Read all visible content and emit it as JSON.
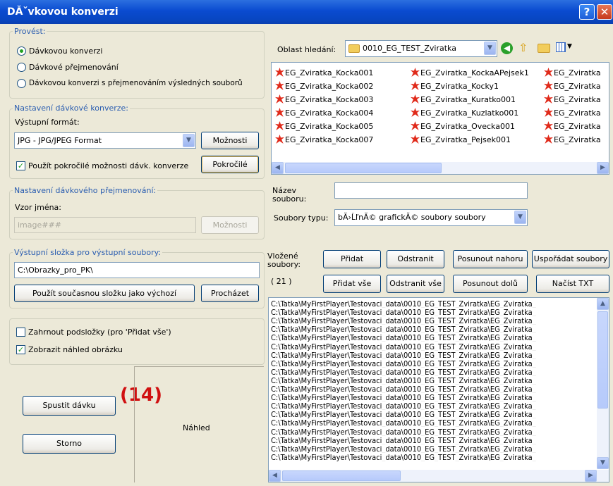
{
  "window": {
    "title": "DĂˇvkovou konverzi",
    "help_icon": "question-icon",
    "close_icon": "close-icon"
  },
  "provest": {
    "legend": "Provést:",
    "options": [
      "Dávkovou konverzi",
      "Dávkové přejmenování",
      "Dávkovou konverzi s přejmenováním výsledných souborů"
    ],
    "selected": 0
  },
  "konverze": {
    "legend": "Nastavení dávkové konverze:",
    "format_label": "Výstupní formát:",
    "format_value": "JPG - JPG/JPEG Format",
    "moznosti_label": "Možnosti",
    "advanced_checkbox_label": "Použít pokročilé možnosti dávk. konverze",
    "advanced_checked": true,
    "pokrocile_label": "Pokročilé"
  },
  "prejmenovani": {
    "legend": "Nastavení dávkového přejmenování:",
    "pattern_label": "Vzor jména:",
    "pattern_value": "image###",
    "moznosti_label": "Možnosti"
  },
  "vystup": {
    "legend": "Výstupní složka pro výstupní soubory:",
    "folder_value": "C:\\Obrazky_pro_PK\\",
    "use_current_label": "Použít současnou složku jako výchozí",
    "browse_label": "Procházet"
  },
  "options": {
    "include_subfolders_label": "Zahrnout podsložky (pro 'Přidat vše')",
    "include_subfolders_checked": false,
    "show_preview_label": "Zobrazit náhled obrázku",
    "show_preview_checked": true
  },
  "actions": {
    "start_label": "Spustit dávku",
    "cancel_label": "Storno",
    "annotation": "(14)"
  },
  "preview": {
    "label": "Náhled"
  },
  "browser": {
    "search_label": "Oblast hledání:",
    "folder_value": "0010_EG_TEST_Zviratka",
    "toolbar_icons": [
      "back-icon",
      "up-folder-icon",
      "new-folder-icon",
      "view-menu-icon"
    ],
    "files_col1": [
      "EG_Zviratka_Kocka001",
      "EG_Zviratka_Kocka002",
      "EG_Zviratka_Kocka003",
      "EG_Zviratka_Kocka004",
      "EG_Zviratka_Kocka005",
      "EG_Zviratka_Kocka007"
    ],
    "files_col2": [
      "EG_Zviratka_KockaAPejsek1",
      "EG_Zviratka_Kocky1",
      "EG_Zviratka_Kuratko001",
      "EG_Zviratka_Kuzlatko001",
      "EG_Zviratka_Ovecka001",
      "EG_Zviratka_Pejsek001"
    ],
    "files_col3": [
      "EG_Zviratka",
      "EG_Zviratka",
      "EG_Zviratka",
      "EG_Zviratka",
      "EG_Zviratka",
      "EG_Zviratka"
    ],
    "filename_label": "Název souboru:",
    "filename_value": "",
    "filetype_label": "Soubory typu:",
    "filetype_value": "bĂ›ĹľnĂ© grafickĂ© soubory soubory"
  },
  "queue": {
    "label": "Vložené soubory:",
    "count": "( 21 )",
    "add_label": "Přidat",
    "remove_label": "Odstranit",
    "move_up_label": "Posunout nahoru",
    "sort_label": "Uspořádat soubory",
    "add_all_label": "Přidat vše",
    "remove_all_label": "Odstranit vše",
    "move_down_label": "Posunout dolů",
    "load_txt_label": "Načíst TXT",
    "items": [
      "C:\\Tatka\\MyFirstPlayer\\Testovaci_data\\0010_EG_TEST_Zviratka\\EG_Zviratka_",
      "C:\\Tatka\\MyFirstPlayer\\Testovaci_data\\0010_EG_TEST_Zviratka\\EG_Zviratka_",
      "C:\\Tatka\\MyFirstPlayer\\Testovaci_data\\0010_EG_TEST_Zviratka\\EG_Zviratka_",
      "C:\\Tatka\\MyFirstPlayer\\Testovaci_data\\0010_EG_TEST_Zviratka\\EG_Zviratka_",
      "C:\\Tatka\\MyFirstPlayer\\Testovaci_data\\0010_EG_TEST_Zviratka\\EG_Zviratka_",
      "C:\\Tatka\\MyFirstPlayer\\Testovaci_data\\0010_EG_TEST_Zviratka\\EG_Zviratka_",
      "C:\\Tatka\\MyFirstPlayer\\Testovaci_data\\0010_EG_TEST_Zviratka\\EG_Zviratka_",
      "C:\\Tatka\\MyFirstPlayer\\Testovaci_data\\0010_EG_TEST_Zviratka\\EG_Zviratka_",
      "C:\\Tatka\\MyFirstPlayer\\Testovaci_data\\0010_EG_TEST_Zviratka\\EG_Zviratka_",
      "C:\\Tatka\\MyFirstPlayer\\Testovaci_data\\0010_EG_TEST_Zviratka\\EG_Zviratka_",
      "C:\\Tatka\\MyFirstPlayer\\Testovaci_data\\0010_EG_TEST_Zviratka\\EG_Zviratka_",
      "C:\\Tatka\\MyFirstPlayer\\Testovaci_data\\0010_EG_TEST_Zviratka\\EG_Zviratka_",
      "C:\\Tatka\\MyFirstPlayer\\Testovaci_data\\0010_EG_TEST_Zviratka\\EG_Zviratka_",
      "C:\\Tatka\\MyFirstPlayer\\Testovaci_data\\0010_EG_TEST_Zviratka\\EG_Zviratka_",
      "C:\\Tatka\\MyFirstPlayer\\Testovaci_data\\0010_EG_TEST_Zviratka\\EG_Zviratka_",
      "C:\\Tatka\\MyFirstPlayer\\Testovaci_data\\0010_EG_TEST_Zviratka\\EG_Zviratka_",
      "C:\\Tatka\\MyFirstPlayer\\Testovaci_data\\0010_EG_TEST_Zviratka\\EG_Zviratka_",
      "C:\\Tatka\\MyFirstPlayer\\Testovaci_data\\0010_EG_TEST_Zviratka\\EG_Zviratka_",
      "C:\\Tatka\\MyFirstPlayer\\Testovaci_data\\0010_EG_TEST_Zviratka\\EG_Zviratka_"
    ]
  }
}
